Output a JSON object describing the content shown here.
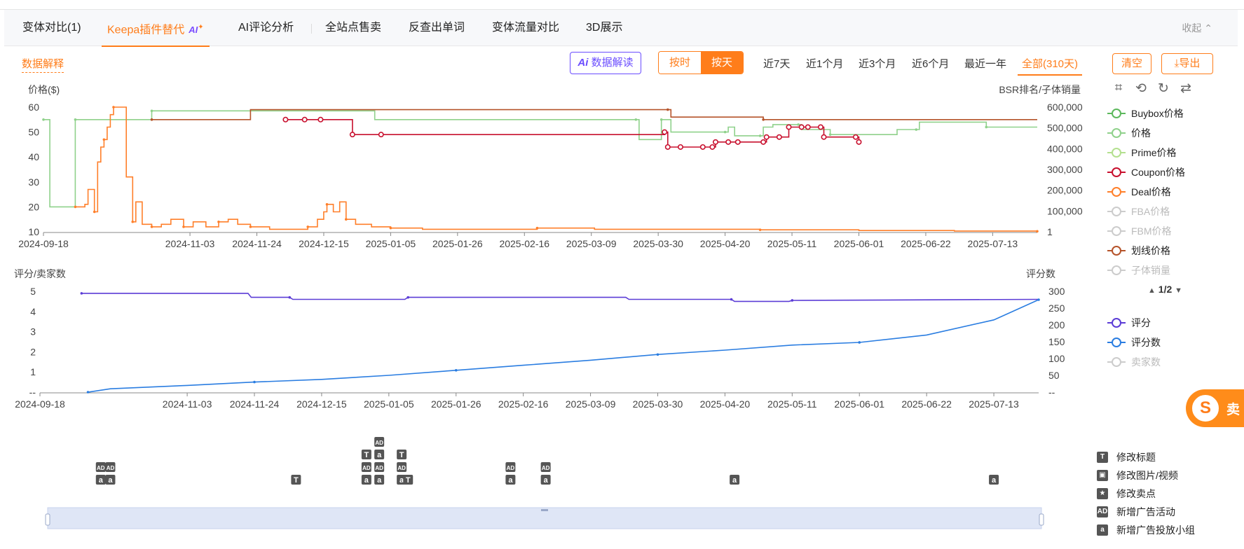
{
  "tabs": [
    {
      "label": "变体对比(1)",
      "active": false
    },
    {
      "label": "Keepa插件替代",
      "active": true,
      "badge": "AI"
    },
    {
      "label": "AI评论分析",
      "active": false
    },
    {
      "label": "全站点售卖",
      "active": false
    },
    {
      "label": "反查出单词",
      "active": false
    },
    {
      "label": "变体流量对比",
      "active": false
    },
    {
      "label": "3D展示",
      "active": false
    }
  ],
  "collapse_label": "收起",
  "explain_label": "数据解释",
  "ai_interpret_label": "数据解读",
  "granularity": {
    "by_hour": "按时",
    "by_day": "按天",
    "selected": "按天"
  },
  "ranges": [
    {
      "label": "近7天",
      "active": false
    },
    {
      "label": "近1个月",
      "active": false
    },
    {
      "label": "近3个月",
      "active": false
    },
    {
      "label": "近6个月",
      "active": false
    },
    {
      "label": "最近一年",
      "active": false
    },
    {
      "label": "全部(310天)",
      "active": true
    }
  ],
  "clear_label": "清空",
  "export_label": "导出",
  "legend_price": [
    {
      "label": "Buybox价格",
      "color": "#5cb85c",
      "active": true
    },
    {
      "label": "价格",
      "color": "#8fd18b",
      "active": true
    },
    {
      "label": "Prime价格",
      "color": "#b3e08f",
      "active": true
    },
    {
      "label": "Coupon价格",
      "color": "#c8102e",
      "active": true
    },
    {
      "label": "Deal价格",
      "color": "#ff7f2a",
      "active": true
    },
    {
      "label": "FBA价格",
      "color": "#cccccc",
      "active": false
    },
    {
      "label": "FBM价格",
      "color": "#cccccc",
      "active": false
    },
    {
      "label": "划线价格",
      "color": "#b5532a",
      "active": true
    },
    {
      "label": "子体销量",
      "color": "#cccccc",
      "active": false
    }
  ],
  "legend_pager": "1/2",
  "legend_rating": [
    {
      "label": "评分",
      "color": "#5b3cd6",
      "active": true
    },
    {
      "label": "评分数",
      "color": "#2a7de1",
      "active": true
    },
    {
      "label": "卖家数",
      "color": "#cccccc",
      "active": false
    }
  ],
  "change_legend": [
    {
      "icon": "T",
      "label": "修改标题"
    },
    {
      "icon": "▣",
      "label": "修改图片/视频"
    },
    {
      "icon": "★",
      "label": "修改卖点"
    },
    {
      "icon": "AD",
      "label": "新增广告活动"
    },
    {
      "icon": "a",
      "label": "新增广告投放小组"
    }
  ],
  "brand_text": "卖",
  "chart_data": [
    {
      "type": "line",
      "ylabel_left": "价格($)",
      "ylabel_right": "BSR排名/子体销量",
      "ylim_left": [
        10,
        60
      ],
      "yticks_left": [
        10,
        20,
        30,
        40,
        50,
        60
      ],
      "yticks_right": [
        "1",
        "100,000",
        "200,000",
        "300,000",
        "400,000",
        "500,000",
        "600,000"
      ],
      "x_range": [
        "2024-09-18",
        "2025-07-27"
      ],
      "xticks": [
        "2024-09-18",
        "2024-11-03",
        "2024-11-24",
        "2024-12-15",
        "2025-01-05",
        "2025-01-26",
        "2025-02-16",
        "2025-03-09",
        "2025-03-30",
        "2025-04-20",
        "2025-05-11",
        "2025-06-01",
        "2025-06-22",
        "2025-07-13"
      ],
      "series": [
        {
          "name": "价格",
          "color": "#8fd18b",
          "points": [
            [
              "2024-09-18",
              55
            ],
            [
              "2024-09-20",
              20
            ],
            [
              "2024-09-27",
              20
            ],
            [
              "2024-09-28",
              55
            ],
            [
              "2024-10-01",
              55
            ],
            [
              "2024-10-19",
              55
            ],
            [
              "2024-10-22",
              58.5
            ],
            [
              "2024-12-30",
              58.5
            ],
            [
              "2024-12-31",
              55
            ],
            [
              "2025-03-23",
              55
            ],
            [
              "2025-03-24",
              47
            ],
            [
              "2025-03-30",
              47
            ],
            [
              "2025-03-31",
              55
            ],
            [
              "2025-04-02",
              55
            ],
            [
              "2025-04-03",
              50
            ],
            [
              "2025-04-20",
              50
            ],
            [
              "2025-04-21",
              52
            ],
            [
              "2025-04-23",
              48.5
            ],
            [
              "2025-05-01",
              48.5
            ],
            [
              "2025-05-02",
              52
            ],
            [
              "2025-05-05",
              53
            ],
            [
              "2025-05-13",
              53
            ],
            [
              "2025-05-14",
              51
            ],
            [
              "2025-05-22",
              51
            ],
            [
              "2025-05-23",
              49
            ],
            [
              "2025-06-12",
              49
            ],
            [
              "2025-06-13",
              51
            ],
            [
              "2025-06-19",
              51
            ],
            [
              "2025-06-20",
              54
            ],
            [
              "2025-07-10",
              54
            ],
            [
              "2025-07-11",
              52
            ],
            [
              "2025-07-27",
              52
            ]
          ]
        },
        {
          "name": "划线价格",
          "color": "#b5532a",
          "points": [
            [
              "2024-10-22",
              55
            ],
            [
              "2024-11-21",
              55
            ],
            [
              "2024-11-22",
              59
            ],
            [
              "2025-04-02",
              59
            ],
            [
              "2025-04-03",
              56
            ],
            [
              "2025-05-01",
              56
            ],
            [
              "2025-05-02",
              55
            ],
            [
              "2025-07-27",
              55
            ]
          ]
        },
        {
          "name": "Coupon价格",
          "color": "#c8102e",
          "points": [
            [
              "2024-12-03",
              55
            ],
            [
              "2024-12-09",
              55
            ],
            [
              "2024-12-14",
              55
            ],
            [
              "2024-12-24",
              49
            ],
            [
              "2025-01-02",
              49
            ],
            [
              "2025-04-01",
              50
            ],
            [
              "2025-04-02",
              44
            ],
            [
              "2025-04-06",
              44
            ],
            [
              "2025-04-13",
              44
            ],
            [
              "2025-04-16",
              44
            ],
            [
              "2025-04-17",
              46
            ],
            [
              "2025-04-21",
              46
            ],
            [
              "2025-04-24",
              46
            ],
            [
              "2025-05-02",
              46
            ],
            [
              "2025-05-03",
              48
            ],
            [
              "2025-05-07",
              48
            ],
            [
              "2025-05-10",
              52
            ],
            [
              "2025-05-14",
              52
            ],
            [
              "2025-05-16",
              52
            ],
            [
              "2025-05-20",
              52
            ],
            [
              "2025-05-21",
              48
            ],
            [
              "2025-05-31",
              48
            ],
            [
              "2025-06-01",
              46
            ]
          ]
        },
        {
          "name": "Deal价格",
          "color": "#ff7f2a",
          "points": [
            [
              "2024-09-28",
              20
            ],
            [
              "2024-10-01",
              21
            ],
            [
              "2024-10-02",
              27
            ],
            [
              "2024-10-04",
              18
            ],
            [
              "2024-10-05",
              38
            ],
            [
              "2024-10-06",
              44
            ],
            [
              "2024-10-07",
              47
            ],
            [
              "2024-10-08",
              52
            ],
            [
              "2024-10-09",
              57
            ],
            [
              "2024-10-10",
              60
            ],
            [
              "2024-10-13",
              60
            ],
            [
              "2024-10-14",
              32
            ],
            [
              "2024-10-16",
              14
            ],
            [
              "2024-10-17",
              22
            ],
            [
              "2024-10-19",
              13
            ],
            [
              "2024-10-22",
              12
            ],
            [
              "2024-10-25",
              13
            ],
            [
              "2024-10-28",
              15
            ],
            [
              "2024-11-01",
              12
            ],
            [
              "2024-11-04",
              14
            ],
            [
              "2024-11-08",
              12
            ],
            [
              "2024-11-12",
              14
            ],
            [
              "2024-11-15",
              15
            ],
            [
              "2024-11-18",
              13
            ],
            [
              "2024-11-22",
              12
            ],
            [
              "2024-11-28",
              11
            ],
            [
              "2024-12-05",
              11
            ],
            [
              "2024-12-10",
              12
            ],
            [
              "2024-12-13",
              15
            ],
            [
              "2024-12-15",
              18
            ],
            [
              "2024-12-16",
              21
            ],
            [
              "2024-12-18",
              18
            ],
            [
              "2024-12-20",
              22
            ],
            [
              "2024-12-22",
              15
            ],
            [
              "2024-12-25",
              13
            ],
            [
              "2024-12-30",
              12
            ],
            [
              "2025-01-05",
              11.5
            ],
            [
              "2025-01-15",
              11
            ],
            [
              "2025-02-01",
              11
            ],
            [
              "2025-02-20",
              11.5
            ],
            [
              "2025-03-10",
              11
            ],
            [
              "2025-04-01",
              11
            ],
            [
              "2025-05-01",
              10.8
            ],
            [
              "2025-06-01",
              10.5
            ],
            [
              "2025-07-01",
              10.3
            ],
            [
              "2025-07-27",
              10.2
            ]
          ]
        }
      ]
    },
    {
      "type": "line",
      "ylabel_left": "评分/卖家数",
      "ylabel_right": "评分数",
      "ylim_left": [
        0,
        5
      ],
      "ylim_right": [
        0,
        300
      ],
      "yticks_left": [
        "--",
        "1",
        "2",
        "3",
        "4",
        "5"
      ],
      "yticks_right": [
        "--",
        "50",
        "100",
        "150",
        "200",
        "250",
        "300"
      ],
      "x_range": [
        "2024-09-18",
        "2025-07-27"
      ],
      "xticks": [
        "2024-09-18",
        "2024-11-03",
        "2024-11-24",
        "2024-12-15",
        "2025-01-05",
        "2025-01-26",
        "2025-02-16",
        "2025-03-09",
        "2025-03-30",
        "2025-04-20",
        "2025-05-11",
        "2025-06-01",
        "2025-06-22",
        "2025-07-13"
      ],
      "series": [
        {
          "name": "评分",
          "axis": "left",
          "color": "#5b3cd6",
          "points": [
            [
              "2024-10-01",
              4.9
            ],
            [
              "2024-11-22",
              4.9
            ],
            [
              "2024-11-23",
              4.7
            ],
            [
              "2024-12-05",
              4.7
            ],
            [
              "2024-12-06",
              4.6
            ],
            [
              "2025-01-10",
              4.6
            ],
            [
              "2025-01-11",
              4.7
            ],
            [
              "2025-03-20",
              4.7
            ],
            [
              "2025-03-21",
              4.6
            ],
            [
              "2025-04-22",
              4.6
            ],
            [
              "2025-04-23",
              4.5
            ],
            [
              "2025-05-10",
              4.5
            ],
            [
              "2025-05-11",
              4.55
            ],
            [
              "2025-07-27",
              4.6
            ]
          ]
        },
        {
          "name": "评分数",
          "axis": "right",
          "color": "#2a7de1",
          "points": [
            [
              "2024-10-03",
              0
            ],
            [
              "2024-10-10",
              10
            ],
            [
              "2024-11-03",
              20
            ],
            [
              "2024-11-24",
              30
            ],
            [
              "2024-12-15",
              38
            ],
            [
              "2025-01-05",
              50
            ],
            [
              "2025-01-26",
              65
            ],
            [
              "2025-02-16",
              80
            ],
            [
              "2025-03-09",
              95
            ],
            [
              "2025-03-30",
              112
            ],
            [
              "2025-04-20",
              125
            ],
            [
              "2025-05-11",
              140
            ],
            [
              "2025-06-01",
              148
            ],
            [
              "2025-06-22",
              170
            ],
            [
              "2025-07-13",
              215
            ],
            [
              "2025-07-27",
              275
            ]
          ]
        }
      ]
    }
  ],
  "change_markers": [
    {
      "date": "2024-10-07",
      "icons": [
        "a",
        "AD"
      ]
    },
    {
      "date": "2024-10-10",
      "icons": [
        "a",
        "AD"
      ]
    },
    {
      "date": "2024-12-07",
      "icons": [
        "T"
      ]
    },
    {
      "date": "2024-12-29",
      "icons": [
        "a",
        "AD",
        "T"
      ]
    },
    {
      "date": "2025-01-02",
      "icons": [
        "a",
        "AD",
        "a",
        "AD"
      ]
    },
    {
      "date": "2025-01-09",
      "icons": [
        "a",
        "AD",
        "T"
      ]
    },
    {
      "date": "2025-01-11",
      "icons": [
        "T"
      ]
    },
    {
      "date": "2025-02-12",
      "icons": [
        "a",
        "AD"
      ]
    },
    {
      "date": "2025-02-23",
      "icons": [
        "a",
        "AD"
      ]
    },
    {
      "date": "2025-04-23",
      "icons": [
        "a"
      ]
    },
    {
      "date": "2025-07-13",
      "icons": [
        "a"
      ]
    }
  ]
}
